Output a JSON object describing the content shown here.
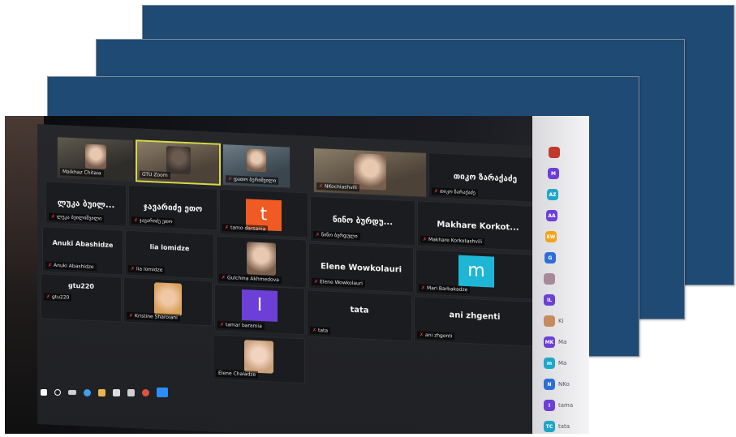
{
  "slides_background": "#1f4a73",
  "tiles": [
    {
      "id": "t1",
      "label": "Malkhaz Chitaia",
      "kind": "video"
    },
    {
      "id": "t2",
      "label": "GTU Zoom",
      "kind": "video",
      "active": true
    },
    {
      "id": "t3",
      "label": "დათო ბერიშვილი",
      "kind": "video"
    },
    {
      "id": "t4",
      "label": "NKochiashvili",
      "kind": "video"
    },
    {
      "id": "t5",
      "big": "თიკო ზარაქაძე",
      "label": "თიკო ზარაქაძე"
    },
    {
      "id": "t6",
      "big": "ლუკა ბუილ...",
      "label": "ლუკა ბუილიშვილი"
    },
    {
      "id": "t7",
      "big": "ჯავარიძე ეთო",
      "label": "ჯავარიძე ეთო"
    },
    {
      "id": "t8",
      "avatar": "t",
      "label": "tamo darsania"
    },
    {
      "id": "t9",
      "big": "ნინო ბურდუ...",
      "label": "ნინო ბურდული"
    },
    {
      "id": "t10",
      "big": "Makhare Korkot...",
      "label": "Makhare Korkotashvili"
    },
    {
      "id": "t11",
      "big": "Anuki Abashidze",
      "label": "Anuki Abashidze"
    },
    {
      "id": "t12",
      "big": "lia lomidze",
      "label": "lia lomidze"
    },
    {
      "id": "t13",
      "label": "Gulchina Akhmedova",
      "kind": "face"
    },
    {
      "id": "t14",
      "big": "Elene Wowkolauri",
      "label": "Elene Wowkolauri"
    },
    {
      "id": "t15",
      "avatar": "m",
      "label": "Mari Barbakadze"
    },
    {
      "id": "t16",
      "big": "gtu220",
      "label": "gtu220"
    },
    {
      "id": "t17",
      "label": "Kristine Sharoiani",
      "kind": "face"
    },
    {
      "id": "t18",
      "avatar": "I",
      "label": "tamar baramia"
    },
    {
      "id": "t19",
      "big": "tata",
      "label": "tata"
    },
    {
      "id": "t20",
      "big": "ani zhgenti",
      "label": "ani zhgenti"
    },
    {
      "id": "t21",
      "label": "Elene Chaladze",
      "kind": "face"
    }
  ],
  "participants": [
    {
      "initials": "",
      "color": "#c0392b",
      "name": ""
    },
    {
      "initials": "M",
      "color": "#6c3fd6",
      "name": ""
    },
    {
      "initials": "AZ",
      "color": "#1fa7c9",
      "name": ""
    },
    {
      "initials": "AA",
      "color": "#6c3fd6",
      "name": ""
    },
    {
      "initials": "EW",
      "color": "#f3a21b",
      "name": ""
    },
    {
      "initials": "G",
      "color": "#2d6fd6",
      "name": ""
    },
    {
      "initials": "",
      "color": "#a8899c",
      "name": ""
    },
    {
      "initials": "IL",
      "color": "#6c3fd6",
      "name": ""
    },
    {
      "initials": "",
      "color": "#c78a5e",
      "name": "Ki"
    },
    {
      "initials": "MK",
      "color": "#6c3fd6",
      "name": "Ma"
    },
    {
      "initials": "m",
      "color": "#1fa7c9",
      "name": "Ma"
    },
    {
      "initials": "N",
      "color": "#2d6fd6",
      "name": "NKo"
    },
    {
      "initials": "I",
      "color": "#6c3fd6",
      "name": "tama"
    },
    {
      "initials": "TC",
      "color": "#1fa7c9",
      "name": "tata"
    }
  ]
}
